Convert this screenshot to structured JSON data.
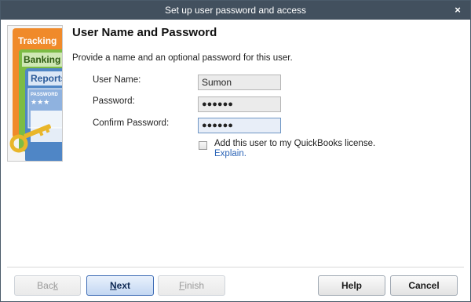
{
  "window": {
    "title": "Set up user password and access",
    "close_glyph": "×"
  },
  "illustration": {
    "tab_tracking": "Tracking",
    "tab_banking": "Banking",
    "tab_reports": "Reports",
    "card_text": "PASSWORD",
    "card_stars": "★★★",
    "colors": {
      "tracking": "#f08a2a",
      "banking": "#7cbc45",
      "reports": "#4f86c6",
      "key": "#e9b62a"
    }
  },
  "content": {
    "title": "User Name and Password",
    "instructions": "Provide a name and an optional password for this user."
  },
  "form": {
    "username_label": "User Name:",
    "username_value": "Sumon",
    "password_label": "Password:",
    "password_masked": "●●●●●●",
    "confirm_label": "Confirm Password:",
    "confirm_masked": "●●●●●●",
    "license_checkbox_label": "Add this user to my QuickBooks license.",
    "license_checked": false,
    "explain_link": "Explain."
  },
  "buttons": {
    "back": {
      "before": "Bac",
      "mnemonic": "k",
      "after": ""
    },
    "next": {
      "before": "",
      "mnemonic": "N",
      "after": "ext"
    },
    "finish": {
      "before": "",
      "mnemonic": "F",
      "after": "inish"
    },
    "help": "Help",
    "cancel": "Cancel"
  }
}
